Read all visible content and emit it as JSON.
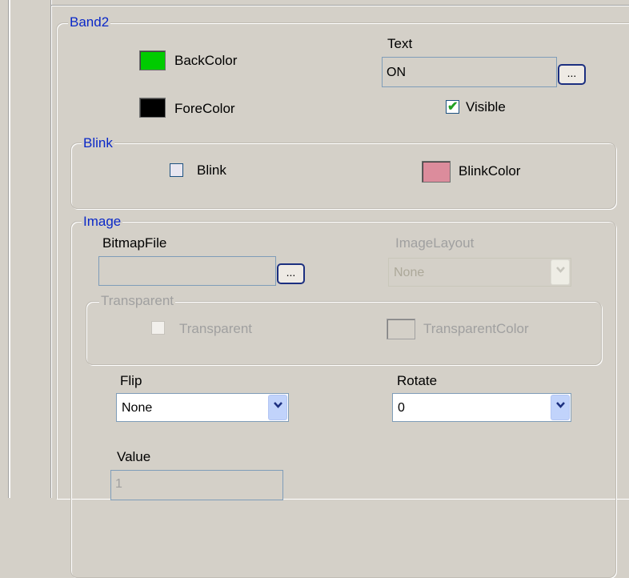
{
  "band": {
    "legend": "Band2",
    "back_color_label": "BackColor",
    "back_color": "#00cc00",
    "fore_color_label": "ForeColor",
    "fore_color": "#000000",
    "text_label": "Text",
    "text_value": "ON",
    "browse_label": "...",
    "visible_label": "Visible",
    "visible_checked": true
  },
  "blink": {
    "legend": "Blink",
    "blink_label": "Blink",
    "blink_checked": false,
    "blink_color_label": "BlinkColor",
    "blink_color": "#dc8c9c"
  },
  "image": {
    "legend": "Image",
    "bitmap_label": "BitmapFile",
    "bitmap_value": "",
    "browse_label": "...",
    "layout_label": "ImageLayout",
    "layout_value": "None",
    "transparent": {
      "legend": "Transparent",
      "checkbox_label": "Transparent",
      "color_label": "TransparentColor"
    },
    "flip_label": "Flip",
    "flip_value": "None",
    "rotate_label": "Rotate",
    "rotate_value": "0"
  },
  "value": {
    "label": "Value",
    "value": "1"
  },
  "colors": {
    "accent_blue": "#0a28c8",
    "background": "#d4d0c8"
  }
}
